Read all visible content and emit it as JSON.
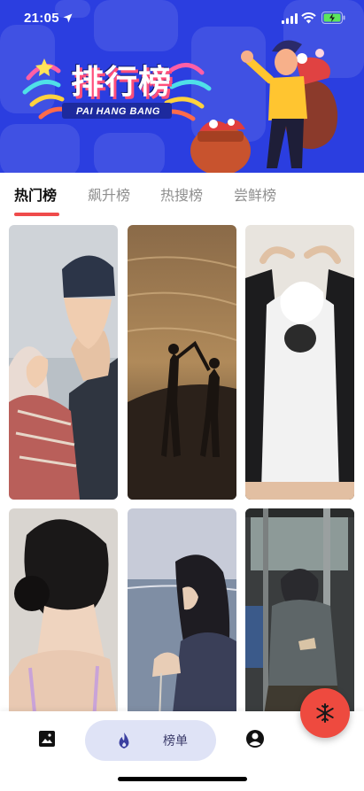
{
  "status_bar": {
    "time": "21:05",
    "icons": [
      "location-arrow-icon",
      "signal-icon",
      "wifi-icon",
      "battery-charging-icon"
    ]
  },
  "banner": {
    "title": "排行榜",
    "subtitle": "PAI HANG BANG",
    "background_color": "#2b3ee0"
  },
  "tabs": [
    {
      "label": "热门榜",
      "active": true
    },
    {
      "label": "飙升榜",
      "active": false
    },
    {
      "label": "热搜榜",
      "active": false
    },
    {
      "label": "尝鲜榜",
      "active": false
    }
  ],
  "accent_color": "#ef4b4b",
  "grid": {
    "items": [
      {
        "subject": "couple-in-winter-hats-photo"
      },
      {
        "subject": "silhouette-couple-at-sunset-beach-photo"
      },
      {
        "subject": "person-with-white-flower-top-photo"
      },
      {
        "subject": "woman-hair-bun-photo"
      },
      {
        "subject": "woman-by-sea-photo"
      },
      {
        "subject": "man-on-bus-photo"
      }
    ]
  },
  "bottom_nav": {
    "items": [
      {
        "icon": "image-icon",
        "label": ""
      },
      {
        "icon": "flame-icon",
        "label": "榜单",
        "active": true
      },
      {
        "icon": "profile-icon",
        "label": ""
      }
    ]
  },
  "fab": {
    "icon": "snowflake-icon",
    "color": "#ee4a3f"
  }
}
